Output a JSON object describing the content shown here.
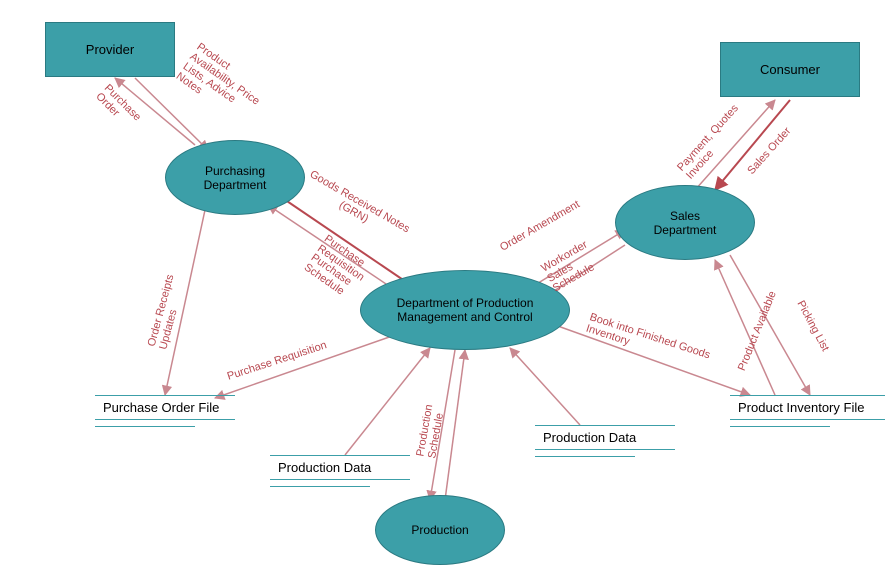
{
  "nodes": {
    "provider": "Provider",
    "consumer": "Consumer",
    "purchasing": "Purchasing\nDepartment",
    "sales": "Sales\nDepartment",
    "dpmc": "Department of Production\nManagement and Control",
    "production": "Production"
  },
  "files": {
    "pof": "Purchase Order File",
    "pd1": "Production Data",
    "pd2": "Production Data",
    "pif": "Product Inventory File"
  },
  "edges": {
    "e1": "Product\nAvailability, Price\nLists, Advice\nNotes",
    "e2": "Purchase\nOrder",
    "e3": "Goods Received Notes\n(GRN)",
    "e4": "Purchase\nRequisition\nPurchase\nSchedule",
    "e5": "Order Receipts\nUpdates",
    "e6": "Purchase Requisition",
    "e7": "Order Amendment",
    "e8": "Workorder\nSales\nSchedule",
    "e9": "Payment, Quotes\nInvoice",
    "e10": "Sales Order",
    "e11": "Book into Finished Goods\nInventory",
    "e12": "Product Available",
    "e13": "Picking List",
    "e14": "Production\nSchedule",
    "colors": {
      "node_fill": "#3c9fa8",
      "label": "#b84850",
      "arrow": "#c98890"
    }
  }
}
